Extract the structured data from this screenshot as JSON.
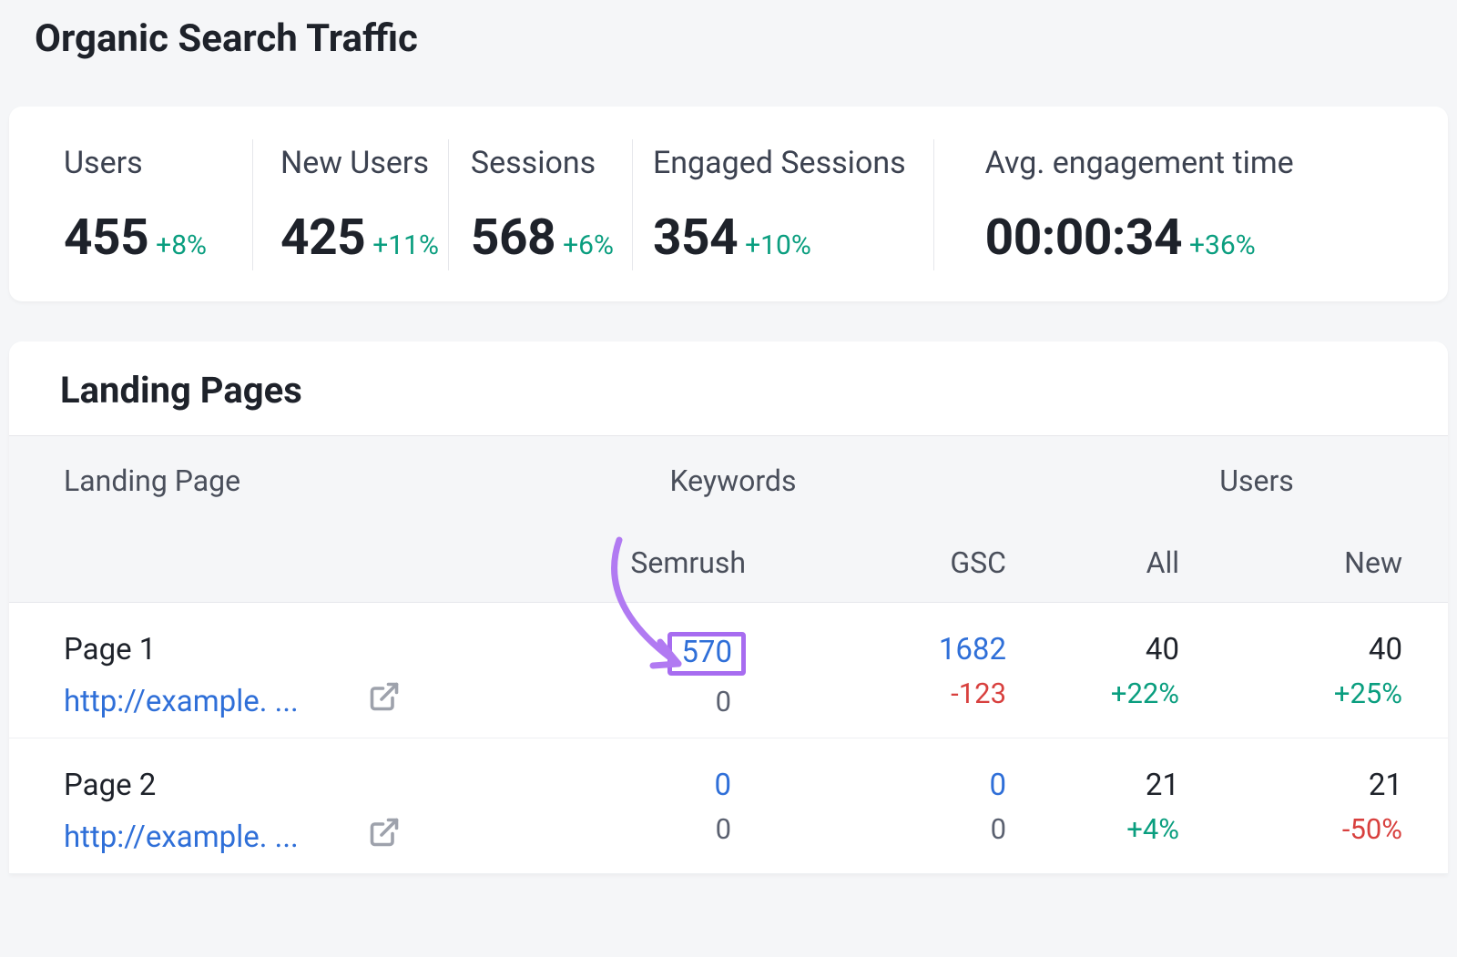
{
  "page_title": "Organic Search Traffic",
  "metrics": [
    {
      "label": "Users",
      "value": "455",
      "delta": "+8%"
    },
    {
      "label": "New Users",
      "value": "425",
      "delta": "+11%"
    },
    {
      "label": "Sessions",
      "value": "568",
      "delta": "+6%"
    },
    {
      "label": "Engaged Sessions",
      "value": "354",
      "delta": "+10%"
    },
    {
      "label": "Avg. engagement time",
      "value": "00:00:34",
      "delta": "+36%"
    }
  ],
  "landing_pages": {
    "title": "Landing Pages",
    "headers": {
      "landing": "Landing Page",
      "keywords": "Keywords",
      "users": "Users",
      "semrush": "Semrush",
      "gsc": "GSC",
      "all": "All",
      "new": "New"
    },
    "rows": [
      {
        "name": "Page 1",
        "url": "http://example. ...",
        "semrush": "570",
        "semrush_sub": "0",
        "gsc": "1682",
        "gsc_delta": "-123",
        "all": "40",
        "all_delta": "+22%",
        "new": "40",
        "new_delta": "+25%",
        "highlight": true
      },
      {
        "name": "Page 2",
        "url": "http://example. ...",
        "semrush": "0",
        "semrush_sub": "0",
        "gsc": "0",
        "gsc_delta": "0",
        "all": "21",
        "all_delta": "+4%",
        "new": "21",
        "new_delta": "-50%",
        "highlight": false
      }
    ]
  }
}
